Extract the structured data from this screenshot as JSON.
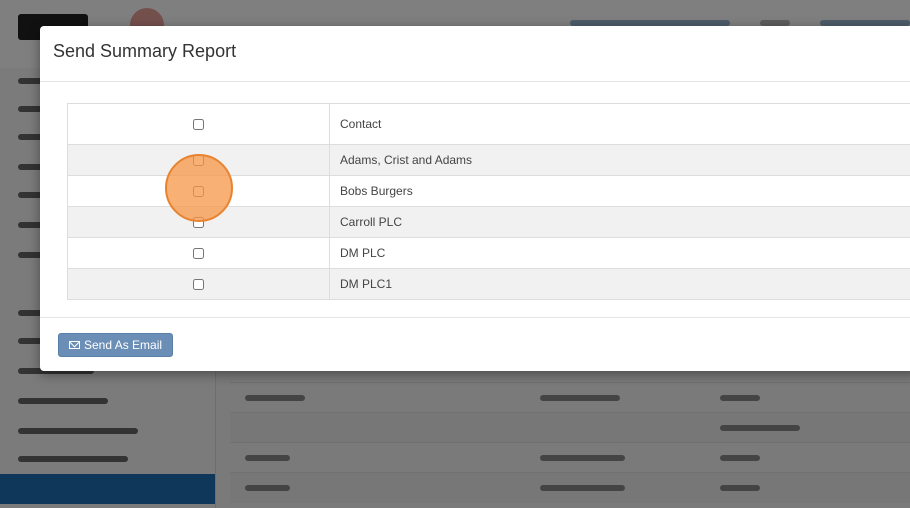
{
  "modal": {
    "title": "Send Summary Report",
    "table": {
      "header": {
        "contact_label": "Contact"
      },
      "rows": [
        {
          "contact": "Adams, Crist and Adams"
        },
        {
          "contact": "Bobs Burgers"
        },
        {
          "contact": "Carroll PLC"
        },
        {
          "contact": "DM PLC"
        },
        {
          "contact": "DM PLC1"
        }
      ]
    },
    "footer": {
      "send_button_label": "Send As Email",
      "send_button_icon": "envelope-icon"
    }
  },
  "colors": {
    "button": "#6a8eb5",
    "highlight": "#f5964a",
    "sidebar_active": "#1e6fb4"
  }
}
